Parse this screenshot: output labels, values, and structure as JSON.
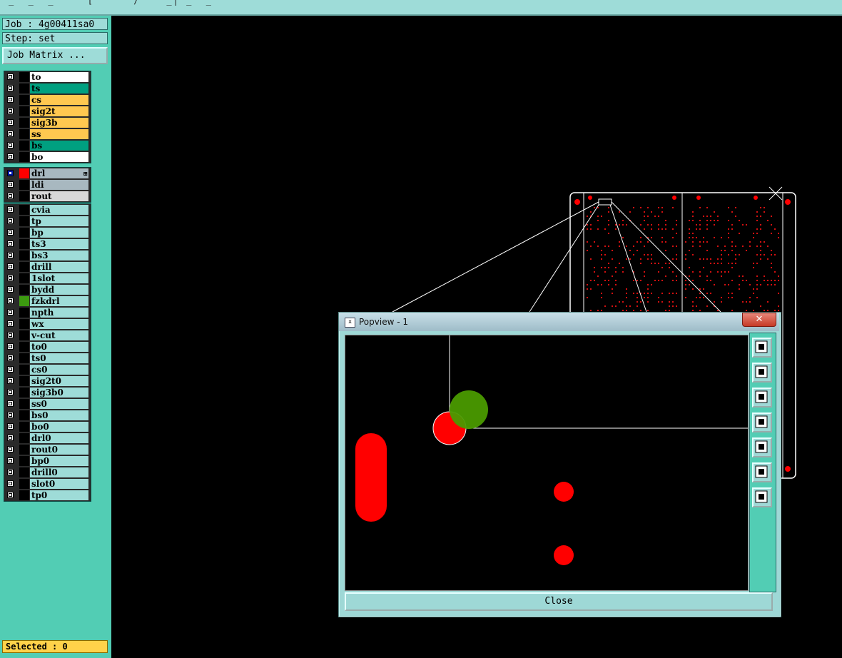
{
  "job": {
    "label": "Job : 4g00411sa0"
  },
  "step": {
    "label": "Step: set"
  },
  "job_matrix_button": "Job Matrix ...",
  "layer_groups": [
    [
      {
        "name": "to",
        "bg": "#ffffff",
        "swatch": "#000000"
      },
      {
        "name": "ts",
        "bg": "#00a080",
        "swatch": "#000000"
      },
      {
        "name": "cs",
        "bg": "#ffc850",
        "swatch": "#000000"
      },
      {
        "name": "sig2t",
        "bg": "#ffc850",
        "swatch": "#000000"
      },
      {
        "name": "sig3b",
        "bg": "#ffc850",
        "swatch": "#000000"
      },
      {
        "name": "ss",
        "bg": "#ffc850",
        "swatch": "#000000"
      },
      {
        "name": "bs",
        "bg": "#00a080",
        "swatch": "#000000"
      },
      {
        "name": "bo",
        "bg": "#ffffff",
        "swatch": "#000000"
      }
    ],
    [
      {
        "name": "drl",
        "bg": "#a8b8c0",
        "swatch": "#ff0000",
        "checked": true,
        "marker": "⊞"
      },
      {
        "name": "ldi",
        "bg": "#a8b8c0",
        "swatch": "#000000"
      },
      {
        "name": "rout",
        "bg": "#d8d8d8",
        "swatch": "#000000"
      }
    ],
    [
      {
        "name": "cvia",
        "bg": "#9edcd8",
        "swatch": "#000000"
      },
      {
        "name": "tp",
        "bg": "#9edcd8",
        "swatch": "#000000"
      },
      {
        "name": "bp",
        "bg": "#9edcd8",
        "swatch": "#000000"
      },
      {
        "name": "ts3",
        "bg": "#9edcd8",
        "swatch": "#000000"
      },
      {
        "name": "bs3",
        "bg": "#9edcd8",
        "swatch": "#000000"
      },
      {
        "name": "drill",
        "bg": "#9edcd8",
        "swatch": "#000000"
      },
      {
        "name": "1slot",
        "bg": "#9edcd8",
        "swatch": "#000000"
      },
      {
        "name": "bydd",
        "bg": "#9edcd8",
        "swatch": "#000000"
      },
      {
        "name": "fzkdrl",
        "bg": "#9edcd8",
        "swatch": "#3c9a10"
      },
      {
        "name": "npth",
        "bg": "#9edcd8",
        "swatch": "#000000"
      },
      {
        "name": "wx",
        "bg": "#9edcd8",
        "swatch": "#000000"
      },
      {
        "name": "v-cut",
        "bg": "#9edcd8",
        "swatch": "#000000"
      },
      {
        "name": "to0",
        "bg": "#9edcd8",
        "swatch": "#000000"
      },
      {
        "name": "ts0",
        "bg": "#9edcd8",
        "swatch": "#000000"
      },
      {
        "name": "cs0",
        "bg": "#9edcd8",
        "swatch": "#000000"
      },
      {
        "name": "sig2t0",
        "bg": "#9edcd8",
        "swatch": "#000000"
      },
      {
        "name": "sig3b0",
        "bg": "#9edcd8",
        "swatch": "#000000"
      },
      {
        "name": "ss0",
        "bg": "#9edcd8",
        "swatch": "#000000"
      },
      {
        "name": "bs0",
        "bg": "#9edcd8",
        "swatch": "#000000"
      },
      {
        "name": "bo0",
        "bg": "#9edcd8",
        "swatch": "#000000"
      },
      {
        "name": "drl0",
        "bg": "#9edcd8",
        "swatch": "#000000"
      },
      {
        "name": "rout0",
        "bg": "#9edcd8",
        "swatch": "#000000"
      },
      {
        "name": "bp0",
        "bg": "#9edcd8",
        "swatch": "#000000"
      },
      {
        "name": "drill0",
        "bg": "#9edcd8",
        "swatch": "#000000"
      },
      {
        "name": "slot0",
        "bg": "#9edcd8",
        "swatch": "#000000"
      },
      {
        "name": "tp0",
        "bg": "#9edcd8",
        "swatch": "#000000"
      }
    ]
  ],
  "selected": {
    "label": "Selected : 0"
  },
  "popview": {
    "title": "Popview - 1",
    "close_label": "Close",
    "close_glyph": "✕",
    "window_icon": "x",
    "toolbar_icons": [
      "zoom-fit-icon",
      "pan-up-icon",
      "pan-down-icon",
      "pan-left-icon",
      "pan-right-icon",
      "zoom-out-icon",
      "zoom-in-icon"
    ]
  },
  "colors": {
    "panel": "#52cdb4",
    "panel_light": "#9edcd8",
    "pad_red": "#ff0000",
    "pad_green": "#4a9a00"
  }
}
